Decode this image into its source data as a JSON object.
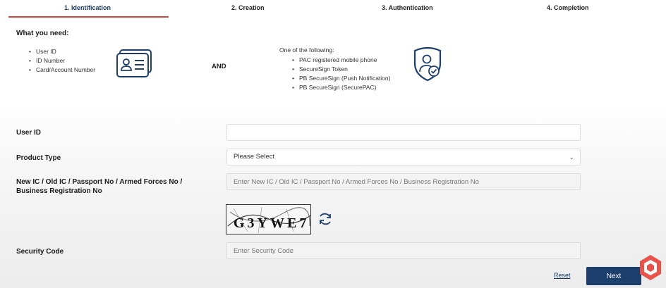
{
  "steps": [
    {
      "label": "1. Identification"
    },
    {
      "label": "2. Creation"
    },
    {
      "label": "3. Authentication"
    },
    {
      "label": "4. Completion"
    }
  ],
  "needs": {
    "title": "What you need:",
    "items": [
      "User ID",
      "ID Number",
      "Card/Account Number"
    ],
    "and_label": "AND",
    "or_title": "One of the following:",
    "or_items": [
      "PAC registered mobile phone",
      "SecureSign Token",
      "PB SecureSign (Push Notification)",
      "PB SecureSign (SecurePAC)"
    ]
  },
  "form": {
    "user_id": {
      "label": "User ID",
      "value": ""
    },
    "product_type": {
      "label": "Product Type",
      "selected": "Please Select"
    },
    "id_number": {
      "label_line1": "New IC / Old IC / Passport No / Armed Forces No /",
      "label_line2": "Business Registration No",
      "placeholder": "Enter New IC / Old IC / Passport No / Armed Forces No / Business Registration No"
    },
    "captcha_text": "G3YWE7",
    "security_code": {
      "label": "Security Code",
      "placeholder": "Enter Security Code"
    }
  },
  "actions": {
    "reset": "Reset",
    "next": "Next"
  },
  "colors": {
    "primary": "#1d3f6e",
    "accent": "#d9453a",
    "logo": "#e8524a"
  }
}
